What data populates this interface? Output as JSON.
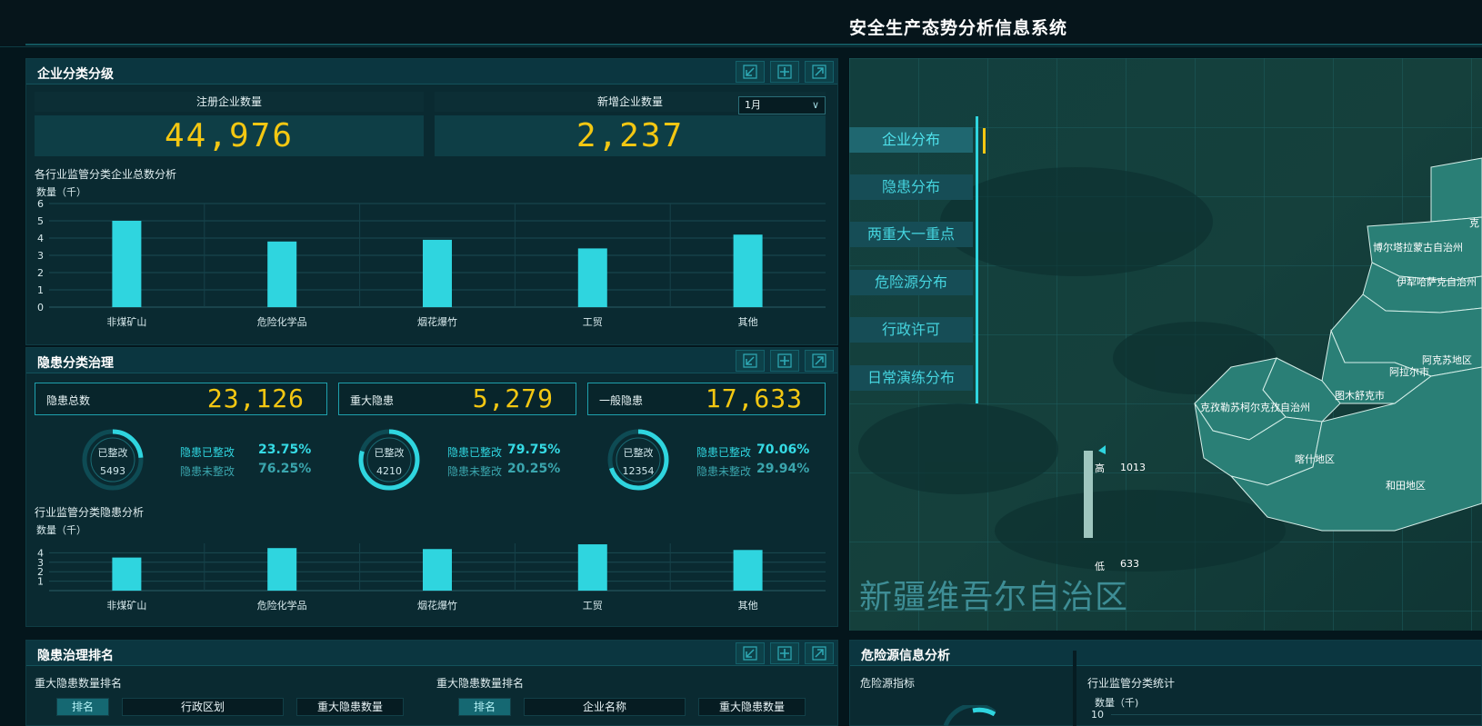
{
  "header": {
    "title": "安全生产态势分析信息系统"
  },
  "enterprise": {
    "title": "企业分类分级",
    "registered_label": "注册企业数量",
    "registered_value": "44,976",
    "new_label": "新增企业数量",
    "new_value": "2,237",
    "month_selected": "1月",
    "chart_title": "各行业监管分类企业总数分析"
  },
  "hazard": {
    "title": "隐患分类治理",
    "cards": [
      {
        "label": "隐患总数",
        "value": "23,126"
      },
      {
        "label": "重大隐患",
        "value": "5,279"
      },
      {
        "label": "一般隐患",
        "value": "17,633"
      }
    ],
    "rings": [
      {
        "center_label": "已整改",
        "count": "5493",
        "fixed_label": "隐患已整改",
        "fixed_pct": "23.75%",
        "unfixed_label": "隐患未整改",
        "unfixed_pct": "76.25%",
        "fraction": 0.2375
      },
      {
        "center_label": "已整改",
        "count": "4210",
        "fixed_label": "隐患已整改",
        "fixed_pct": "79.75%",
        "unfixed_label": "隐患未整改",
        "unfixed_pct": "20.25%",
        "fraction": 0.7975
      },
      {
        "center_label": "已整改",
        "count": "12354",
        "fixed_label": "隐患已整改",
        "fixed_pct": "70.06%",
        "unfixed_label": "隐患未整改",
        "unfixed_pct": "29.94%",
        "fraction": 0.7006
      }
    ],
    "chart_title": "行业监管分类隐患分析"
  },
  "ranking": {
    "title": "隐患治理排名",
    "left_title": "重大隐患数量排名",
    "left_cols": [
      "排名",
      "行政区划",
      "重大隐患数量"
    ],
    "right_title": "重大隐患数量排名",
    "right_cols": [
      "排名",
      "企业名称",
      "重大隐患数量"
    ]
  },
  "danger": {
    "title": "危险源信息分析",
    "indicator_label": "危险源指标",
    "stat_label": "行业监管分类统计",
    "ylabel": "数量（千)",
    "ytop": "10"
  },
  "map": {
    "menu": [
      "企业分布",
      "隐患分布",
      "两重大一重点",
      "危险源分布",
      "行政许可",
      "日常演练分布"
    ],
    "region_name": "新疆维吾尔自治区",
    "legend_high": "高",
    "legend_low": "低",
    "legend_max": "1013",
    "legend_min": "633",
    "places": [
      "克",
      "博尔塔拉蒙古自治州",
      "伊犁哈萨克自治州",
      "阿克苏地区",
      "阿拉尔市",
      "图木舒克市",
      "克孜勒苏柯尔克孜自治州",
      "喀什地区",
      "和田地区"
    ],
    "colors": {
      "land": "#2a7f76",
      "accent": "#2fd5df"
    }
  },
  "chart_data": [
    {
      "type": "bar",
      "title": "各行业监管分类企业总数分析",
      "ylabel": "数量（千）",
      "categories": [
        "非煤矿山",
        "危险化学品",
        "烟花爆竹",
        "工贸",
        "其他"
      ],
      "values": [
        5.0,
        3.8,
        3.9,
        3.4,
        4.2
      ],
      "ylim": [
        0,
        6
      ],
      "yticks": [
        "0",
        "1",
        "2",
        "3",
        "4",
        "5",
        "6"
      ],
      "grid": true,
      "color": "#2fd5df"
    },
    {
      "type": "bar",
      "title": "行业监管分类隐患分析",
      "ylabel": "数量（千）",
      "categories": [
        "非煤矿山",
        "危险化学品",
        "烟花爆竹",
        "工贸",
        "其他"
      ],
      "values": [
        3.5,
        4.5,
        4.4,
        4.9,
        4.3
      ],
      "ylim": [
        0,
        5
      ],
      "yticks": [
        "1",
        "2",
        "3",
        "4"
      ],
      "grid": true,
      "color": "#2fd5df"
    }
  ]
}
